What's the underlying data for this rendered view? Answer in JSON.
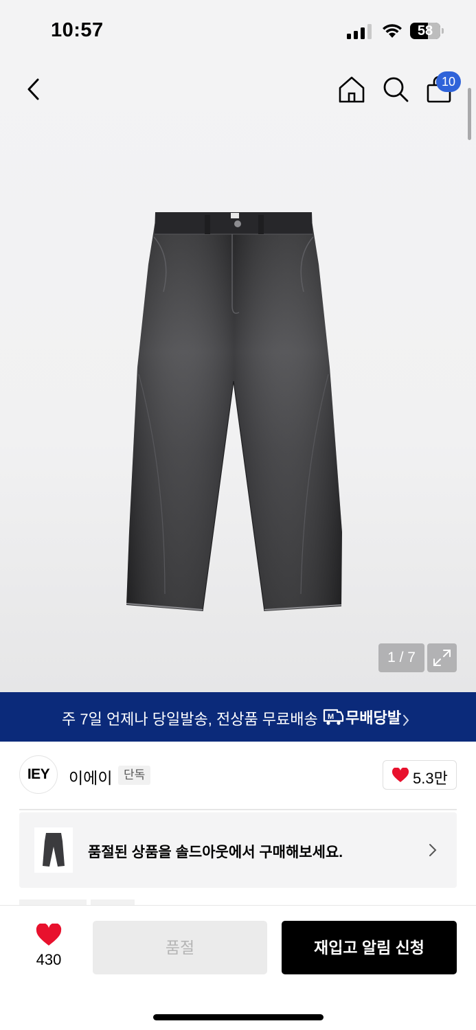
{
  "status_bar": {
    "time": "10:57",
    "battery_level": "58",
    "battery_fraction": 0.58,
    "icons": [
      "signal-icon",
      "wifi-icon",
      "battery-icon"
    ]
  },
  "header": {
    "icons": [
      "back-icon",
      "home-icon",
      "search-icon",
      "cart-icon"
    ],
    "cart_count": "10"
  },
  "gallery": {
    "counter": "1 / 7",
    "product_image": "black-wide-denim-pants",
    "expand_icon": "expand-icon"
  },
  "promo_banner": {
    "text": "주 7일 언제나 당일발송, 전상품 무료배송",
    "brand": "무배당발",
    "logo_icon": "delivery-truck-icon",
    "background": "#0b2a7a"
  },
  "brand": {
    "logo_text": "IEY",
    "name": "이에이",
    "badge": "단독",
    "likes": "5.3만"
  },
  "soldout_notice": {
    "text": "품절된 상품을 솔드아웃에서 구매해보세요."
  },
  "bottom_bar": {
    "wish_count": "430",
    "soldout_label": "품절",
    "restock_label": "재입고 알림 신청",
    "heart_color": "#e8112d"
  }
}
